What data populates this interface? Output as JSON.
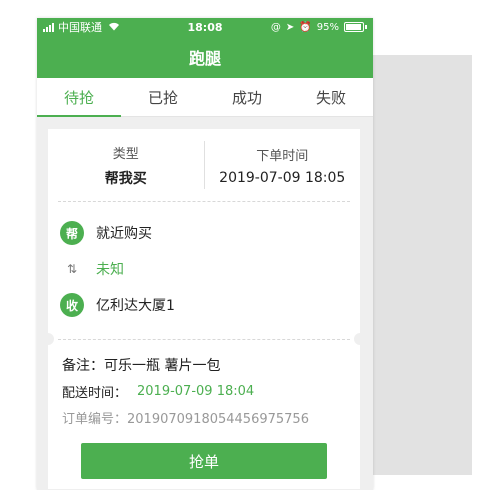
{
  "status_bar": {
    "carrier": "中国联通",
    "time": "18:08",
    "battery": "95%",
    "battery_level": 0.95
  },
  "header": {
    "title": "跑腿"
  },
  "tabs": [
    {
      "label": "待抢",
      "active": true
    },
    {
      "label": "已抢",
      "active": false
    },
    {
      "label": "成功",
      "active": false
    },
    {
      "label": "失败",
      "active": false
    }
  ],
  "order": {
    "type_label": "类型",
    "type_value": "帮我买",
    "time_label": "下单时间",
    "time_value": "2019-07-09 18:05",
    "from_badge": "帮",
    "from_text": "就近购买",
    "distance_text": "未知",
    "to_badge": "收",
    "to_text": "亿利达大厦1",
    "note": "备注：可乐一瓶 薯片一包",
    "delivery_label": "配送时间：",
    "delivery_value": "2019-07-09 18:04",
    "order_no": "订单编号：20190709180544569757​56",
    "grab_button": "抢单"
  },
  "colors": {
    "accent": "#4caf50"
  },
  "icons": [
    "signal-icon",
    "wifi-icon",
    "at-icon",
    "location-arrow-icon",
    "alarm-icon",
    "battery-icon",
    "swap-arrows-icon"
  ]
}
